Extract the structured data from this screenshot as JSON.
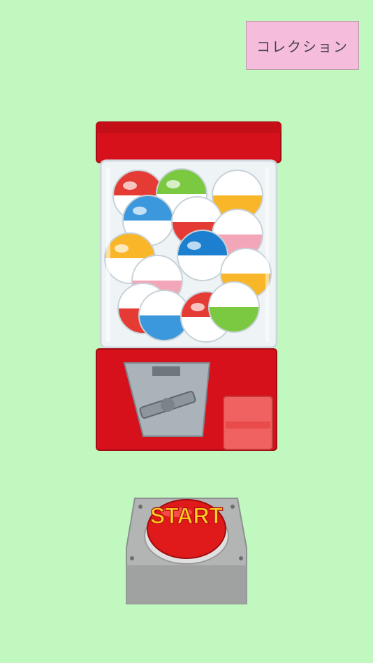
{
  "collection_button": {
    "label": "コレクション"
  },
  "start_button": {
    "label": "START"
  },
  "colors": {
    "background": "#c1f8c0",
    "collection_button": "#f6bcdc",
    "machine_red": "#d7111b",
    "button_red": "#e01a1a",
    "start_text": "#ffd21f"
  },
  "capsules": [
    {
      "top": "#e53b35",
      "bottom": "#ffffff"
    },
    {
      "top": "#7bc841",
      "bottom": "#ffffff"
    },
    {
      "top": "#ffffff",
      "bottom": "#f9b629"
    },
    {
      "top": "#3b98dc",
      "bottom": "#ffffff"
    },
    {
      "top": "#ffffff",
      "bottom": "#e53b35"
    },
    {
      "top": "#ffffff",
      "bottom": "#f4a6b9"
    },
    {
      "top": "#f9b629",
      "bottom": "#ffffff"
    },
    {
      "top": "#1d7fd0",
      "bottom": "#ffffff"
    },
    {
      "top": "#ffffff",
      "bottom": "#f4a6b9"
    },
    {
      "top": "#ffffff",
      "bottom": "#f9b629"
    },
    {
      "top": "#ffffff",
      "bottom": "#e53b35"
    },
    {
      "top": "#ffffff",
      "bottom": "#3b98dc"
    },
    {
      "top": "#e53b35",
      "bottom": "#ffffff"
    },
    {
      "top": "#ffffff",
      "bottom": "#7bc841"
    }
  ]
}
